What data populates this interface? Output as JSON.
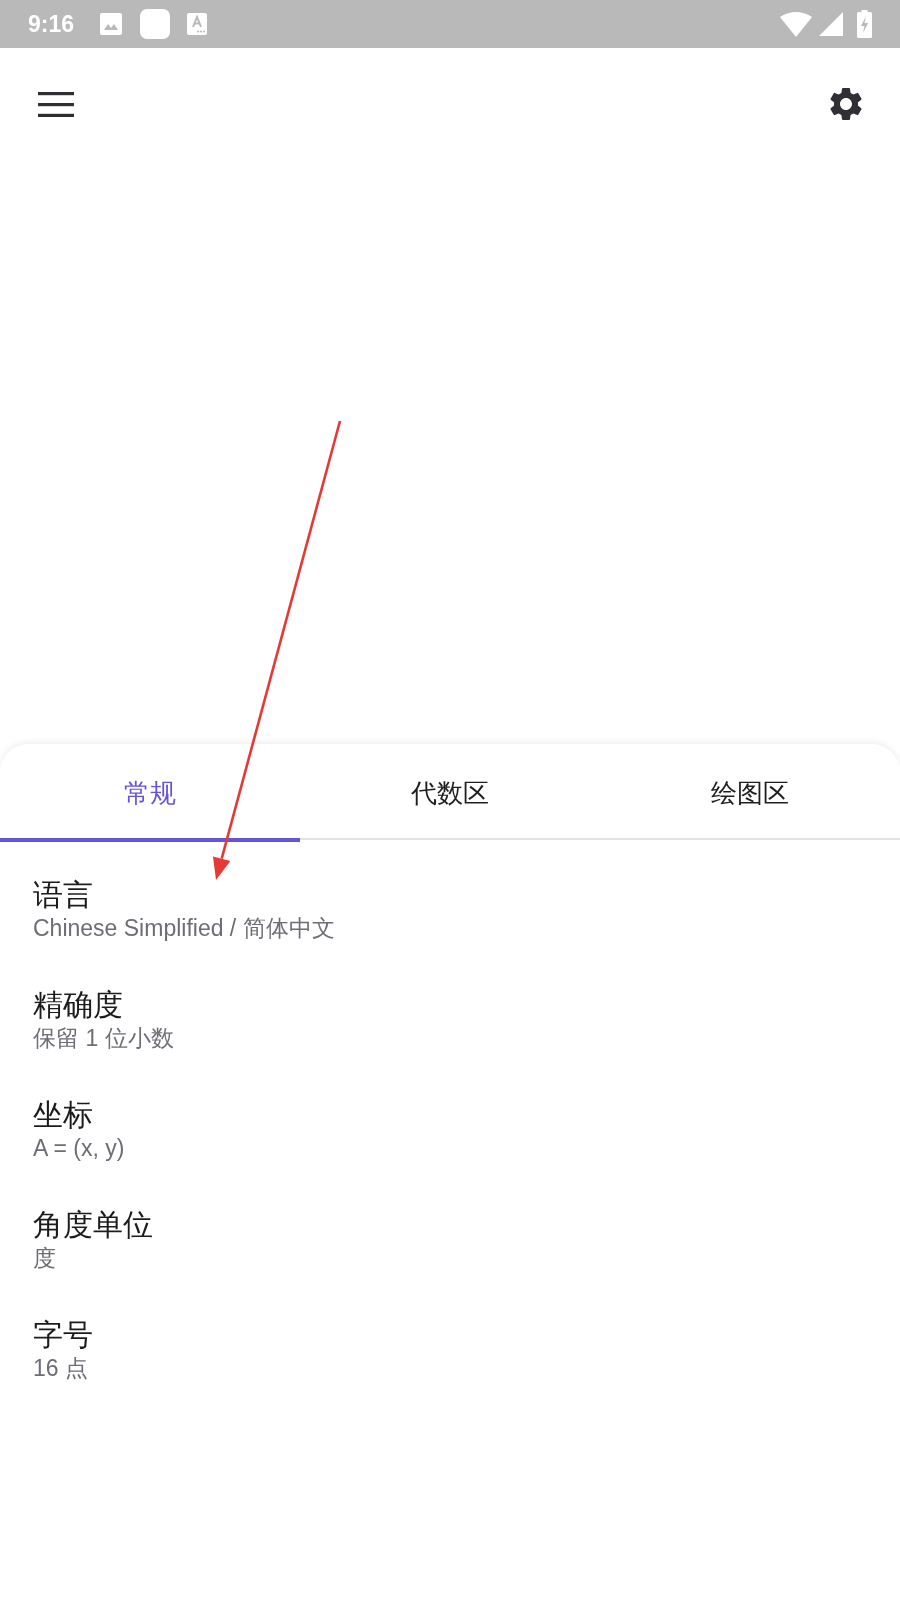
{
  "status_bar": {
    "time": "9:16"
  },
  "tabs": [
    {
      "label": "常规",
      "selected": true
    },
    {
      "label": "代数区",
      "selected": false
    },
    {
      "label": "绘图区",
      "selected": false
    }
  ],
  "settings": [
    {
      "title": "语言",
      "value": "Chinese Simplified / 简体中文"
    },
    {
      "title": "精确度",
      "value": "保留 1 位小数"
    },
    {
      "title": "坐标",
      "value": "A = (x, y)"
    },
    {
      "title": "角度单位",
      "value": "度"
    },
    {
      "title": "字号",
      "value": "16 点"
    }
  ]
}
